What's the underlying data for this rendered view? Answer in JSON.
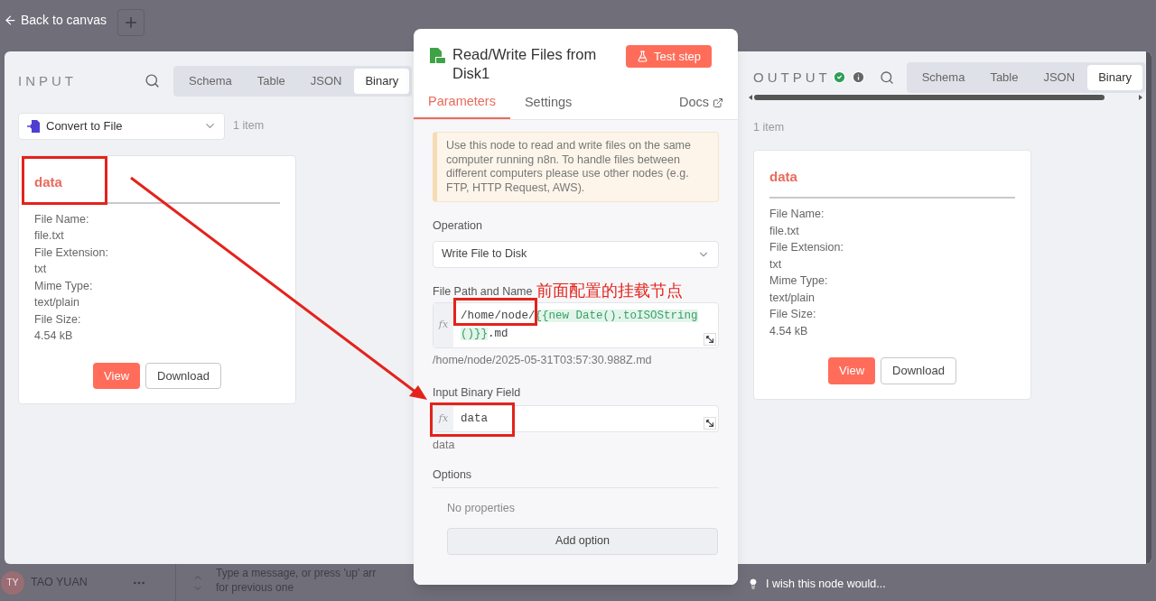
{
  "header": {
    "back_label": "Back to canvas"
  },
  "input": {
    "title": "INPUT",
    "tabs": [
      {
        "label": "Schema",
        "selected": false
      },
      {
        "label": "Table",
        "selected": false
      },
      {
        "label": "JSON",
        "selected": false
      },
      {
        "label": "Binary",
        "selected": true
      }
    ],
    "node_select": "Convert to File",
    "item_count": "1 item",
    "binary": {
      "key": "data",
      "fields": [
        {
          "label": "File Name:",
          "value": "file.txt"
        },
        {
          "label": "File Extension:",
          "value": "txt"
        },
        {
          "label": "Mime Type:",
          "value": "text/plain"
        },
        {
          "label": "File Size:",
          "value": "4.54 kB"
        }
      ],
      "view_button": "View",
      "download_button": "Download"
    }
  },
  "node": {
    "title": "Read/Write Files from Disk1",
    "test_button": "Test step",
    "tabs": [
      {
        "label": "Parameters",
        "selected": true
      },
      {
        "label": "Settings",
        "selected": false
      }
    ],
    "docs": "Docs",
    "notice": "Use this node to read and write files on the same computer running n8n. To handle files between different computers please use other nodes (e.g. FTP, HTTP Request, AWS).",
    "operation": {
      "label": "Operation",
      "value": "Write File to Disk"
    },
    "file_path": {
      "label": "File Path and Name",
      "prefix": "/home/node/",
      "expression": "{{new Date().toISOString()}}",
      "suffix": ".md",
      "fx": "fx",
      "resolved": "/home/node/2025-05-31T03:57:30.988Z.md"
    },
    "binary_field": {
      "label": "Input Binary Field",
      "value": "data",
      "fx": "fx",
      "resolved": "data"
    },
    "options": {
      "label": "Options",
      "empty": "No properties",
      "button": "Add option"
    }
  },
  "output": {
    "title": "OUTPUT",
    "tabs": [
      {
        "label": "Schema",
        "selected": false
      },
      {
        "label": "Table",
        "selected": false
      },
      {
        "label": "JSON",
        "selected": false
      },
      {
        "label": "Binary",
        "selected": true
      }
    ],
    "item_count": "1 item",
    "binary": {
      "key": "data",
      "fields": [
        {
          "label": "File Name:",
          "value": "file.txt"
        },
        {
          "label": "File Extension:",
          "value": "txt"
        },
        {
          "label": "Mime Type:",
          "value": "text/plain"
        },
        {
          "label": "File Size:",
          "value": "4.54 kB"
        }
      ],
      "view_button": "View",
      "download_button": "Download"
    }
  },
  "annotation": {
    "text": "前面配置的挂载节点"
  },
  "chat": {
    "user_initials": "TY",
    "user_name": "TAO YUAN",
    "placeholder": "Type a message, or press 'up' arr",
    "placeholder_line2": "for previous one"
  },
  "feedback": "I wish this node would..."
}
